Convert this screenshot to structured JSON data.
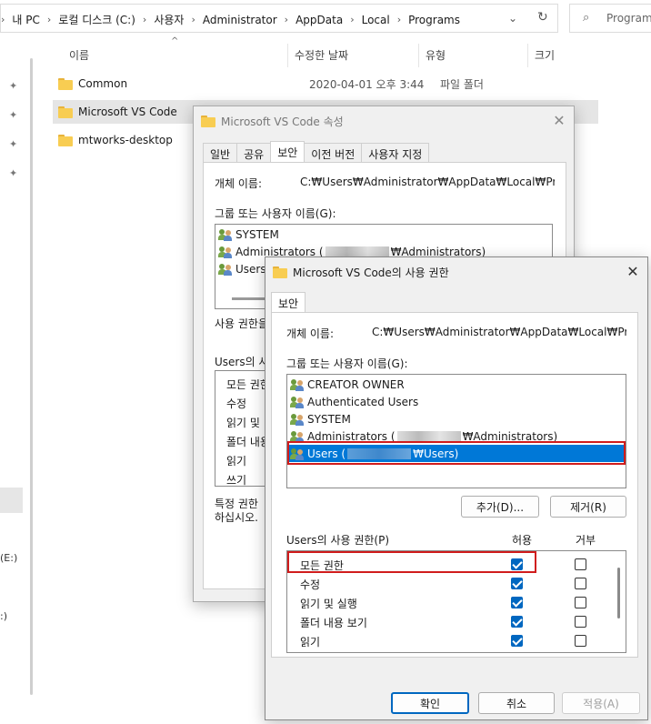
{
  "explorer": {
    "breadcrumbs": [
      "내 PC",
      "로컬 디스크 (C:)",
      "사용자",
      "Administrator",
      "AppData",
      "Local",
      "Programs"
    ],
    "search_placeholder": "Programs",
    "columns": {
      "name": "이름",
      "date": "수정한 날짜",
      "type": "유형",
      "size": "크기"
    },
    "files": [
      {
        "name": "Common",
        "date": "2020-04-01 오후 3:44",
        "type": "파일 폴더"
      },
      {
        "name": "Microsoft VS Code",
        "date": "",
        "type": ""
      },
      {
        "name": "mtworks-desktop",
        "date": "",
        "type": ""
      }
    ],
    "nav_drives": [
      "(E:)",
      ":)"
    ]
  },
  "props_dialog": {
    "title": "Microsoft VS Code 속성",
    "tabs": [
      "일반",
      "공유",
      "보안",
      "이전 버전",
      "사용자 지정"
    ],
    "active_tab": "보안",
    "object_name_label": "개체 이름:",
    "object_name_value": "C:₩Users₩Administrator₩AppData₩Local₩Programs",
    "group_label": "그룹 또는 사용자 이름(G):",
    "groups": [
      {
        "prefix": "SYSTEM",
        "suffix": ""
      },
      {
        "prefix": "Administrators (",
        "suffix": "₩Administrators)"
      },
      {
        "prefix": "Users",
        "suffix": ""
      }
    ],
    "edit_hint": "사용 권한을",
    "perm_label": "Users의 사",
    "perms": [
      "모든 권한",
      "수정",
      "읽기 및",
      "폴더 내용",
      "읽기",
      "쓰기"
    ],
    "special_note_1": "특정 권한",
    "special_note_2": "하십시오."
  },
  "perm_dialog": {
    "title": "Microsoft VS Code의 사용 권한",
    "tab": "보안",
    "object_name_label": "개체 이름:",
    "object_name_value": "C:₩Users₩Administrator₩AppData₩Local₩Programs",
    "group_label": "그룹 또는 사용자 이름(G):",
    "groups": [
      {
        "prefix": "CREATOR OWNER",
        "suffix": ""
      },
      {
        "prefix": "Authenticated Users",
        "suffix": ""
      },
      {
        "prefix": "SYSTEM",
        "suffix": ""
      },
      {
        "prefix": "Administrators (",
        "suffix": "₩Administrators)"
      },
      {
        "prefix": "Users (",
        "suffix": "₩Users)"
      }
    ],
    "selected_group_index": 4,
    "add_button": "추가(D)...",
    "remove_button": "제거(R)",
    "perm_label": "Users의 사용 권한(P)",
    "allow_header": "허용",
    "deny_header": "거부",
    "perms": [
      {
        "name": "모든 권한",
        "allow": true,
        "deny": false
      },
      {
        "name": "수정",
        "allow": true,
        "deny": false
      },
      {
        "name": "읽기 및 실행",
        "allow": true,
        "deny": false
      },
      {
        "name": "폴더 내용 보기",
        "allow": true,
        "deny": false
      },
      {
        "name": "읽기",
        "allow": true,
        "deny": false
      }
    ],
    "ok_button": "확인",
    "cancel_button": "취소",
    "apply_button": "적용(A)"
  },
  "colors": {
    "accent": "#0067c0",
    "highlight": "#0078d7",
    "annotation": "#d01c1c"
  }
}
